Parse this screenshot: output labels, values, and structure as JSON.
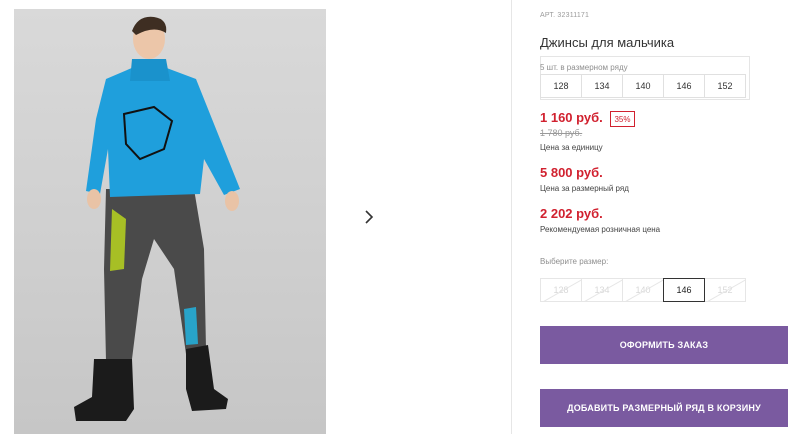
{
  "gallery": {
    "next_icon": "chevron-right-icon"
  },
  "product": {
    "article": "АРТ. 32311171",
    "title": "Джинсы для мальчика",
    "size_row_note": "5 шт. в размерном ряду",
    "size_row": [
      "128",
      "134",
      "140",
      "146",
      "152"
    ],
    "price_current": "1 160 руб.",
    "discount": "35%",
    "price_old": "1 780 руб.",
    "price_unit_label": "Цена за единицу",
    "price_row": "5 800 руб.",
    "price_row_label": "Цена за размерный ряд",
    "price_retail": "2 202 руб.",
    "price_retail_label": "Рекомендуемая розничная цена",
    "choose_size_label": "Выберите размер:",
    "choose_sizes": [
      {
        "label": "128",
        "available": false
      },
      {
        "label": "134",
        "available": false
      },
      {
        "label": "140",
        "available": false
      },
      {
        "label": "146",
        "available": true,
        "selected": true
      },
      {
        "label": "152",
        "available": false
      }
    ],
    "order_button": "ОФОРМИТЬ ЗАКАЗ",
    "add_row_button": "ДОБАВИТЬ РАЗМЕРНЫЙ РЯД В КОРЗИНУ"
  },
  "colors": {
    "accent_purple": "#7a5aa0",
    "price_red": "#d1212f"
  }
}
